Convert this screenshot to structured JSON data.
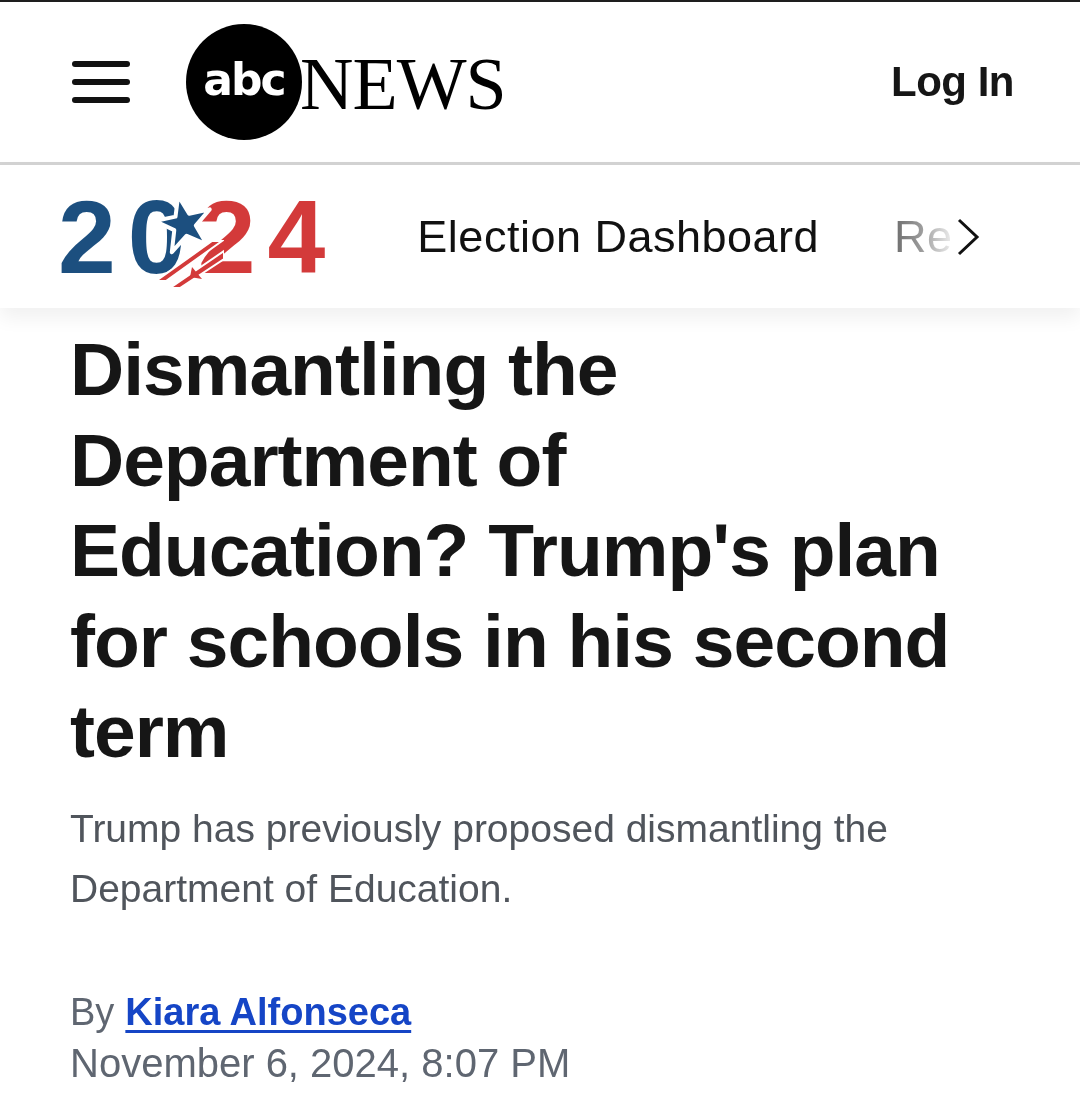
{
  "header": {
    "logo": {
      "mark": "abc",
      "wordmark": "NEWS"
    },
    "login": "Log In"
  },
  "subnav": {
    "logo_text": "2024",
    "items": [
      {
        "label": "Election Dashboard"
      },
      {
        "label": "Re"
      }
    ]
  },
  "article": {
    "headline": "Dismantling the Department of Education? Trump's plan for schools in his second term",
    "summary": "Trump has previously proposed dismantling the Department of Education.",
    "byline": {
      "prefix": "By",
      "author": "Kiara Alfonseca"
    },
    "date": "November 6, 2024, 8:07 PM"
  }
}
